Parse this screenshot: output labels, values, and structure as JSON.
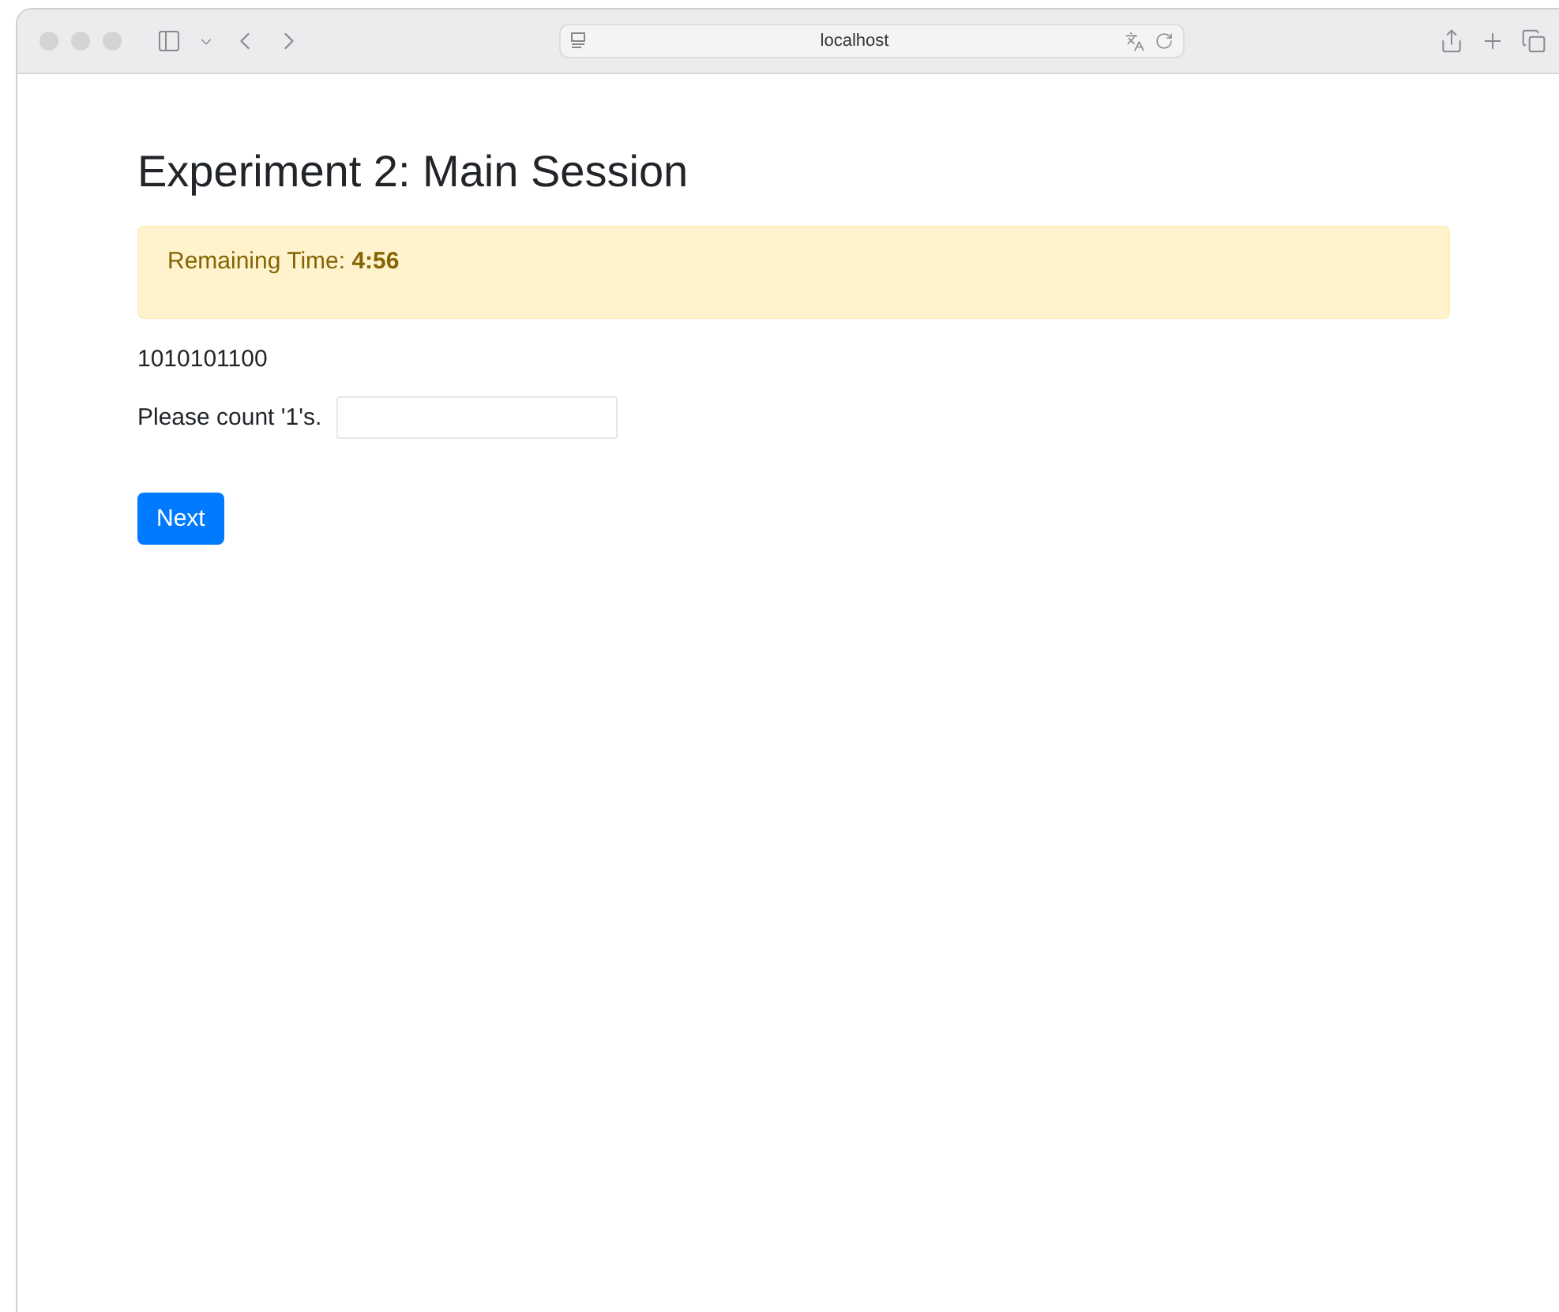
{
  "browser": {
    "address": "localhost"
  },
  "page": {
    "title": "Experiment 2: Main Session",
    "alert": {
      "label": "Remaining Time:",
      "value": "4:56"
    },
    "sequence": "1010101100",
    "question": {
      "label": "Please count '1's."
    },
    "buttons": [
      "Next"
    ]
  }
}
